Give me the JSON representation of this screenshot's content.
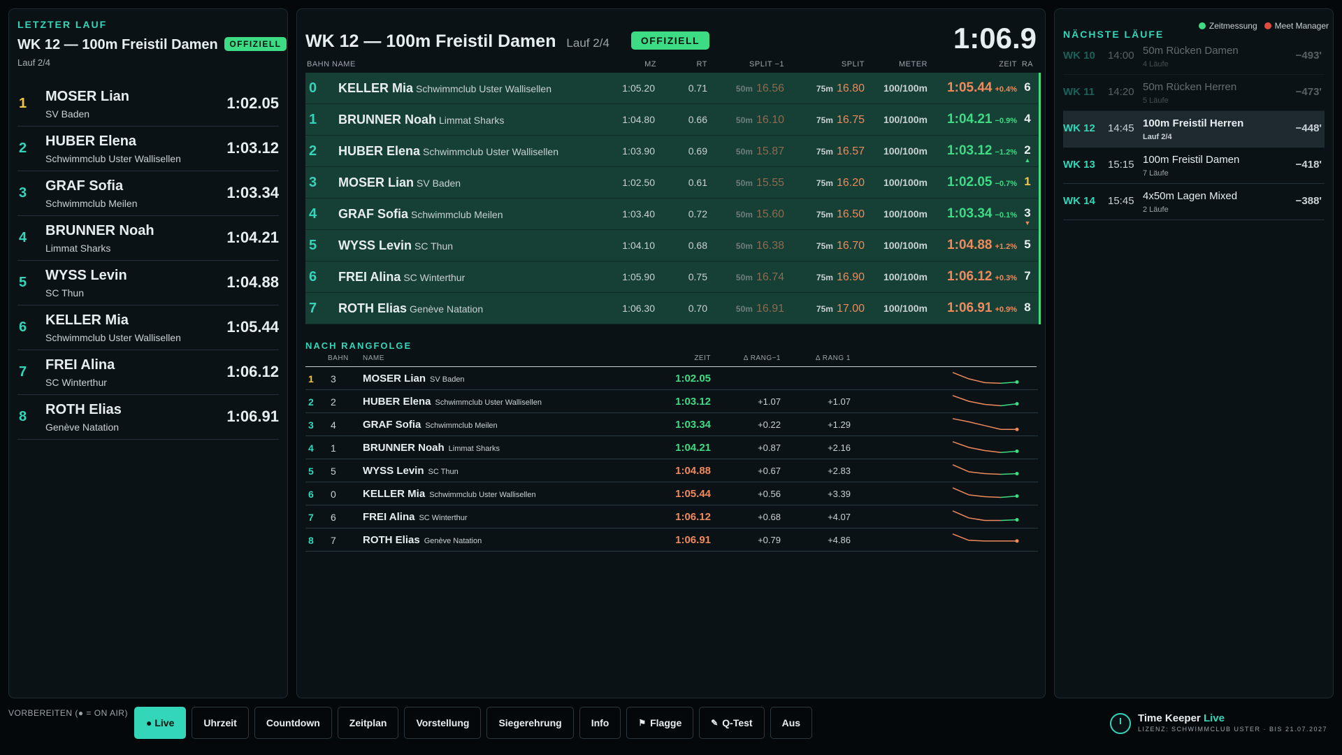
{
  "left": {
    "section": "LETZTER LAUF",
    "title": "WK 12 — 100m Freistil Damen",
    "badge": "OFFIZIELL",
    "subtitle": "Lauf 2/4",
    "results": [
      {
        "rank": "1",
        "name": "MOSER Lian",
        "club": "SV Baden",
        "time": "1:02.05"
      },
      {
        "rank": "2",
        "name": "HUBER Elena",
        "club": "Schwimmclub Uster Wallisellen",
        "time": "1:03.12"
      },
      {
        "rank": "3",
        "name": "GRAF Sofia",
        "club": "Schwimmclub Meilen",
        "time": "1:03.34"
      },
      {
        "rank": "4",
        "name": "BRUNNER Noah",
        "club": "Limmat Sharks",
        "time": "1:04.21"
      },
      {
        "rank": "5",
        "name": "WYSS Levin",
        "club": "SC Thun",
        "time": "1:04.88"
      },
      {
        "rank": "6",
        "name": "KELLER Mia",
        "club": "Schwimmclub Uster Wallisellen",
        "time": "1:05.44"
      },
      {
        "rank": "7",
        "name": "FREI Alina",
        "club": "SC Winterthur",
        "time": "1:06.12"
      },
      {
        "rank": "8",
        "name": "ROTH Elias",
        "club": "Genève Natation",
        "time": "1:06.91"
      }
    ]
  },
  "center": {
    "title": "WK 12 — 100m Freistil Damen",
    "heat": "Lauf 2/4",
    "badge": "OFFIZIELL",
    "clock": "1:06.9",
    "columns": {
      "bahn": "BAHN",
      "name": "NAME",
      "mz": "MZ",
      "rt": "RT",
      "split_prev": "SPLIT −1",
      "split": "SPLIT",
      "meter": "METER",
      "zeit": "ZEIT",
      "ra": "RA"
    },
    "lanes": [
      {
        "lane": "0",
        "name": "KELLER Mia",
        "club": "Schwimmclub Uster Wallisellen",
        "mz": "1:05.20",
        "rt": "0.71",
        "split_prev_label": "50m",
        "split_prev": "16.56",
        "split_label": "75m",
        "split": "16.80",
        "meter": "100/100m",
        "time": "1:05.44",
        "delta": "+0.4%",
        "rank": "6",
        "arrow": ""
      },
      {
        "lane": "1",
        "name": "BRUNNER Noah",
        "club": "Limmat Sharks",
        "mz": "1:04.80",
        "rt": "0.66",
        "split_prev_label": "50m",
        "split_prev": "16.10",
        "split_label": "75m",
        "split": "16.75",
        "meter": "100/100m",
        "time": "1:04.21",
        "delta": "−0.9%",
        "rank": "4",
        "arrow": ""
      },
      {
        "lane": "2",
        "name": "HUBER Elena",
        "club": "Schwimmclub Uster Wallisellen",
        "mz": "1:03.90",
        "rt": "0.69",
        "split_prev_label": "50m",
        "split_prev": "15.87",
        "split_label": "75m",
        "split": "16.57",
        "meter": "100/100m",
        "time": "1:03.12",
        "delta": "−1.2%",
        "rank": "2",
        "arrow": "▲"
      },
      {
        "lane": "3",
        "name": "MOSER Lian",
        "club": "SV Baden",
        "mz": "1:02.50",
        "rt": "0.61",
        "split_prev_label": "50m",
        "split_prev": "15.55",
        "split_label": "75m",
        "split": "16.20",
        "meter": "100/100m",
        "time": "1:02.05",
        "delta": "−0.7%",
        "rank": "1",
        "arrow": ""
      },
      {
        "lane": "4",
        "name": "GRAF Sofia",
        "club": "Schwimmclub Meilen",
        "mz": "1:03.40",
        "rt": "0.72",
        "split_prev_label": "50m",
        "split_prev": "15.60",
        "split_label": "75m",
        "split": "16.50",
        "meter": "100/100m",
        "time": "1:03.34",
        "delta": "−0.1%",
        "rank": "3",
        "arrow": "▼"
      },
      {
        "lane": "5",
        "name": "WYSS Levin",
        "club": "SC Thun",
        "mz": "1:04.10",
        "rt": "0.68",
        "split_prev_label": "50m",
        "split_prev": "16.38",
        "split_label": "75m",
        "split": "16.70",
        "meter": "100/100m",
        "time": "1:04.88",
        "delta": "+1.2%",
        "rank": "5",
        "arrow": ""
      },
      {
        "lane": "6",
        "name": "FREI Alina",
        "club": "SC Winterthur",
        "mz": "1:05.90",
        "rt": "0.75",
        "split_prev_label": "50m",
        "split_prev": "16.74",
        "split_label": "75m",
        "split": "16.90",
        "meter": "100/100m",
        "time": "1:06.12",
        "delta": "+0.3%",
        "rank": "7",
        "arrow": ""
      },
      {
        "lane": "7",
        "name": "ROTH Elias",
        "club": "Genève Natation",
        "mz": "1:06.30",
        "rt": "0.70",
        "split_prev_label": "50m",
        "split_prev": "16.91",
        "split_label": "75m",
        "split": "17.00",
        "meter": "100/100m",
        "time": "1:06.91",
        "delta": "+0.9%",
        "rank": "8",
        "arrow": ""
      }
    ],
    "ranking": {
      "section": "NACH RANGFOLGE",
      "columns": {
        "bahn": "BAHN",
        "name": "NAME",
        "zeit": "ZEIT",
        "d_prev": "Δ RANG−1",
        "d_first": "Δ RANG 1"
      },
      "rows": [
        {
          "rank": "1",
          "lane": "3",
          "name": "MOSER Lian",
          "club": "SV Baden",
          "time": "1:02.05",
          "d_prev": "",
          "d_first": "",
          "spark": [
            3,
            2,
            1.4,
            1.3,
            1.5
          ]
        },
        {
          "rank": "2",
          "lane": "2",
          "name": "HUBER Elena",
          "club": "Schwimmclub Uster Wallisellen",
          "time": "1:03.12",
          "d_prev": "+1.07",
          "d_first": "+1.07",
          "spark": [
            3,
            2.1,
            1.6,
            1.4,
            1.7
          ]
        },
        {
          "rank": "3",
          "lane": "4",
          "name": "GRAF Sofia",
          "club": "Schwimmclub Meilen",
          "time": "1:03.34",
          "d_prev": "+0.22",
          "d_first": "+1.29",
          "spark": [
            3,
            2.5,
            1.9,
            1.3,
            1.3
          ]
        },
        {
          "rank": "4",
          "lane": "1",
          "name": "BRUNNER Noah",
          "club": "Limmat Sharks",
          "time": "1:04.21",
          "d_prev": "+0.87",
          "d_first": "+2.16",
          "spark": [
            3,
            2.1,
            1.6,
            1.3,
            1.5
          ]
        },
        {
          "rank": "5",
          "lane": "5",
          "name": "WYSS Levin",
          "club": "SC Thun",
          "time": "1:04.88",
          "d_prev": "+0.67",
          "d_first": "+2.83",
          "spark": [
            3,
            1.9,
            1.6,
            1.5,
            1.6
          ]
        },
        {
          "rank": "6",
          "lane": "0",
          "name": "KELLER Mia",
          "club": "Schwimmclub Uster Wallisellen",
          "time": "1:05.44",
          "d_prev": "+0.56",
          "d_first": "+3.39",
          "spark": [
            3,
            1.9,
            1.6,
            1.5,
            1.7
          ]
        },
        {
          "rank": "7",
          "lane": "6",
          "name": "FREI Alina",
          "club": "SC Winterthur",
          "time": "1:06.12",
          "d_prev": "+0.68",
          "d_first": "+4.07",
          "spark": [
            3,
            1.9,
            1.5,
            1.5,
            1.6
          ]
        },
        {
          "rank": "8",
          "lane": "7",
          "name": "ROTH Elias",
          "club": "Genève Natation",
          "time": "1:06.91",
          "d_prev": "+0.79",
          "d_first": "+4.86",
          "spark": [
            3,
            2.0,
            1.9,
            1.9,
            1.9
          ]
        }
      ]
    }
  },
  "right": {
    "section": "NÄCHSTE LÄUFE",
    "status": [
      {
        "label": "Zeitmessung",
        "color": "#3ddc84"
      },
      {
        "label": "Meet Manager",
        "color": "#e04b3f"
      }
    ],
    "events": [
      {
        "wk": "WK 10",
        "time": "14:00",
        "event": "50m Rücken Damen",
        "heats": "4 Läufe",
        "countdown": "−493'",
        "state": "past"
      },
      {
        "wk": "WK 11",
        "time": "14:20",
        "event": "50m Rücken Herren",
        "heats": "5 Läufe",
        "countdown": "−473'",
        "state": "past"
      },
      {
        "wk": "WK 12",
        "time": "14:45",
        "event": "100m Freistil Herren",
        "heats": "Lauf 2/4",
        "countdown": "−448'",
        "state": "current"
      },
      {
        "wk": "WK 13",
        "time": "15:15",
        "event": "100m Freistil Damen",
        "heats": "7 Läufe",
        "countdown": "−418'",
        "state": "upcoming"
      },
      {
        "wk": "WK 14",
        "time": "15:45",
        "event": "4x50m Lagen Mixed",
        "heats": "2 Läufe",
        "countdown": "−388'",
        "state": "upcoming"
      }
    ]
  },
  "bottom": {
    "prep_label": "VORBEREITEN (● = ON AIR)",
    "buttons": [
      {
        "label": "● Live",
        "icon": "",
        "active": true
      },
      {
        "label": "Uhrzeit",
        "icon": "",
        "active": false
      },
      {
        "label": "Countdown",
        "icon": "",
        "active": false
      },
      {
        "label": "Zeitplan",
        "icon": "",
        "active": false
      },
      {
        "label": "Vorstellung",
        "icon": "",
        "active": false
      },
      {
        "label": "Siegerehrung",
        "icon": "",
        "active": false
      },
      {
        "label": "Info",
        "icon": "",
        "active": false
      },
      {
        "label": "Flagge",
        "icon": "flag-icon",
        "active": false
      },
      {
        "label": "Q-Test",
        "icon": "wrench-icon",
        "active": false
      },
      {
        "label": "Aus",
        "icon": "",
        "active": false
      }
    ],
    "brand": {
      "name": "Time Keeper",
      "name_accent": "Live",
      "license": "LIZENZ: SCHWIMMCLUB USTER · BIS 21.07.2027"
    }
  }
}
